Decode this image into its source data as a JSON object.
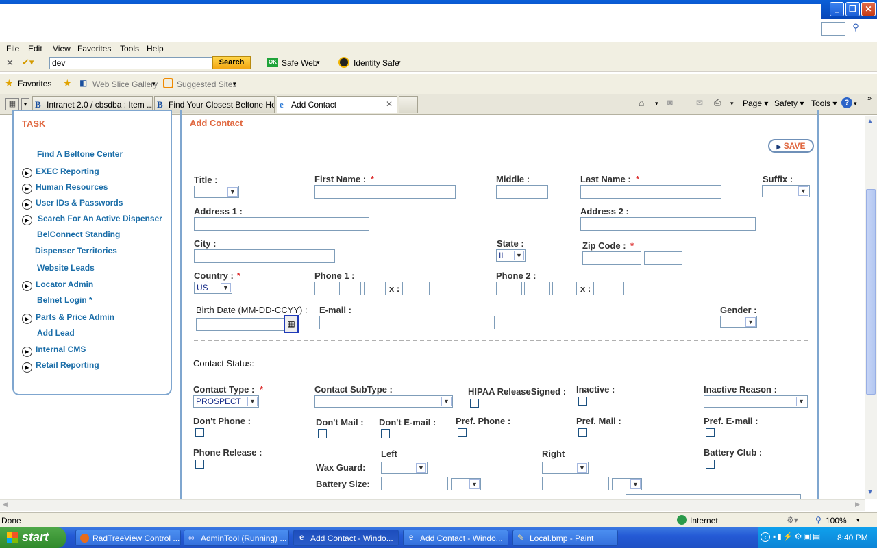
{
  "browser": {
    "menu": [
      "File",
      "Edit",
      "View",
      "Favorites",
      "Tools",
      "Help"
    ],
    "search_value": "dev",
    "search_button": "Search",
    "safe_web": "Safe Web",
    "identity_safe": "Identity Safe",
    "favorites": "Favorites",
    "web_slice": "Web Slice Gallery",
    "suggested": "Suggested Sites",
    "tabs": [
      "Intranet 2.0 / cbsdba : Item ...",
      "Find Your Closest Beltone He...",
      "Add Contact"
    ],
    "cmd": {
      "page": "Page",
      "safety": "Safety",
      "tools": "Tools"
    },
    "status": "Done",
    "zone": "Internet",
    "zoom": "100%"
  },
  "taskbar": {
    "start": "start",
    "items": [
      "RadTreeView Control ...",
      "AdminTool (Running) ...",
      "Add Contact - Windo...",
      "Add Contact - Windo...",
      "Local.bmp - Paint"
    ],
    "clock": "8:40 PM"
  },
  "task": {
    "title": "TASK",
    "items": [
      "Find A Beltone Center",
      "EXEC Reporting",
      "Human Resources",
      "User IDs & Passwords",
      "Search For An Active Dispenser",
      "BelConnect Standing",
      "Dispenser Territories",
      "Website Leads",
      "Locator Admin",
      "Belnet Login *",
      "Parts & Price Admin",
      "Add Lead",
      "Internal CMS",
      "Retail Reporting"
    ]
  },
  "form": {
    "title": "Add Contact",
    "save": "SAVE",
    "req": "*",
    "labels": {
      "title": "Title :",
      "first_name": "First Name :",
      "middle": "Middle :",
      "last_name": "Last Name :",
      "suffix": "Suffix :",
      "address1": "Address 1 :",
      "address2": "Address 2 :",
      "city": "City :",
      "state": "State :",
      "zip": "Zip Code :",
      "country": "Country :",
      "phone1": "Phone 1 :",
      "phone2": "Phone 2 :",
      "x": "x :",
      "birth": "Birth Date (MM-DD-CCYY) :",
      "email": "E-mail :",
      "gender": "Gender :",
      "contact_status": "Contact Status:",
      "contact_type": "Contact Type :",
      "contact_subtype": "Contact SubType :",
      "hipaa": "HIPAA ReleaseSigned :",
      "inactive": "Inactive :",
      "inactive_reason": "Inactive Reason :",
      "dont_phone": "Don't Phone :",
      "dont_mail": "Don't Mail :",
      "dont_email": "Don't E-mail :",
      "pref_phone": "Pref. Phone :",
      "pref_mail": "Pref. Mail :",
      "pref_email": "Pref. E-mail :",
      "phone_release": "Phone Release :",
      "left": "Left",
      "right": "Right",
      "battery_club": "Battery Club :",
      "wax_guard": "Wax Guard:",
      "battery_size": "Battery Size:"
    },
    "values": {
      "state": "IL",
      "country": "US",
      "contact_type": "PROSPECT"
    }
  }
}
